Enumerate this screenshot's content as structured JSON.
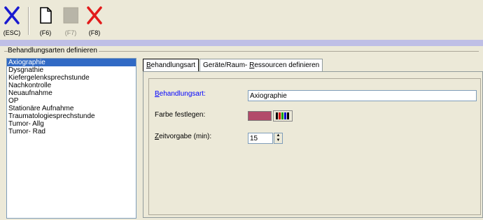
{
  "toolbar": {
    "buttons": [
      {
        "key": "(ESC)",
        "icon": "close-x-blue-icon",
        "enabled": true
      },
      {
        "key": "(F6)",
        "icon": "new-document-icon",
        "enabled": true
      },
      {
        "key": "(F7)",
        "icon": "save-disabled-icon",
        "enabled": false
      },
      {
        "key": "(F8)",
        "icon": "delete-x-red-icon",
        "enabled": true
      }
    ]
  },
  "group": {
    "title": "Behandlungsarten definieren"
  },
  "list": {
    "items": [
      "Axiographie",
      "Dysgnathie",
      "Kiefergelenksprechstunde",
      "Nachkontrolle",
      "Neuaufnahme",
      "OP",
      "Stationäre Aufnahme",
      "Traumatologiesprechstunde",
      "Tumor- Allg",
      "Tumor- Rad"
    ],
    "selected_index": 0
  },
  "tabs": [
    {
      "label_prefix": "",
      "label_u": "B",
      "label_rest": "ehandlungsart",
      "active": true
    },
    {
      "label_prefix": "Geräte/Raum- ",
      "label_u": "R",
      "label_rest": "essourcen definieren",
      "active": false
    }
  ],
  "form": {
    "behandlungsart": {
      "label_u": "B",
      "label_rest": "ehandlungsart:",
      "value": "Axiographie"
    },
    "farbe": {
      "label": "Farbe festlegen:",
      "color": "#b24a6a"
    },
    "zeitvorgabe": {
      "label_u": "Z",
      "label_rest": "eitvorgabe (min):",
      "value": "15"
    }
  },
  "colors": {
    "selection": "#316ac5",
    "label_blue": "#0000ff",
    "bluebar": "#bfbfe6"
  }
}
